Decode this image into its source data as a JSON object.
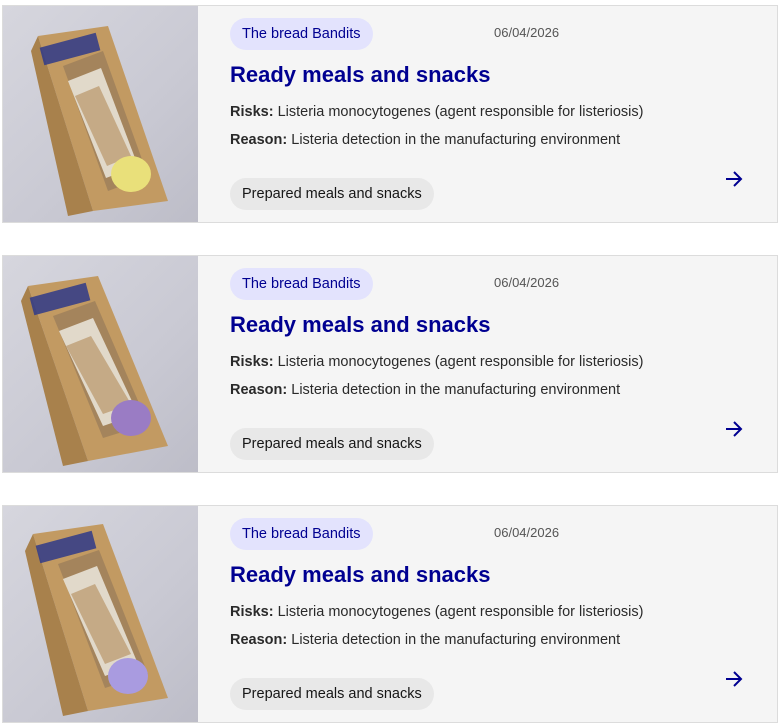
{
  "cards": [
    {
      "brand": "The bread Bandits",
      "date": "06/04/2026",
      "title": "Ready meals and snacks",
      "risks_label": "Risks:",
      "risks_text": "Listeria monocytogenes (agent responsible for listeriosis)",
      "reason_label": "Reason:",
      "reason_text": "Listeria detection in the manufacturing environment",
      "category": "Prepared meals and snacks",
      "sticker_color": "#e9e07a"
    },
    {
      "brand": "The bread Bandits",
      "date": "06/04/2026",
      "title": "Ready meals and snacks",
      "risks_label": "Risks:",
      "risks_text": "Listeria monocytogenes (agent responsible for listeriosis)",
      "reason_label": "Reason:",
      "reason_text": "Listeria detection in the manufacturing environment",
      "category": "Prepared meals and snacks",
      "sticker_color": "#9a7cc4"
    },
    {
      "brand": "The bread Bandits",
      "date": "06/04/2026",
      "title": "Ready meals and snacks",
      "risks_label": "Risks:",
      "risks_text": "Listeria monocytogenes (agent responsible for listeriosis)",
      "reason_label": "Reason:",
      "reason_text": "Listeria detection in the manufacturing environment",
      "category": "Prepared meals and snacks",
      "sticker_color": "#a99be0"
    }
  ],
  "theme": {
    "accent": "#000091",
    "tag_bg": "#e3e3fd",
    "card_bg": "#f5f5f5",
    "chip_bg": "#e8e8e8"
  },
  "icons": {
    "product_image": "sandwich-package-image",
    "arrow": "arrow-right-icon"
  }
}
